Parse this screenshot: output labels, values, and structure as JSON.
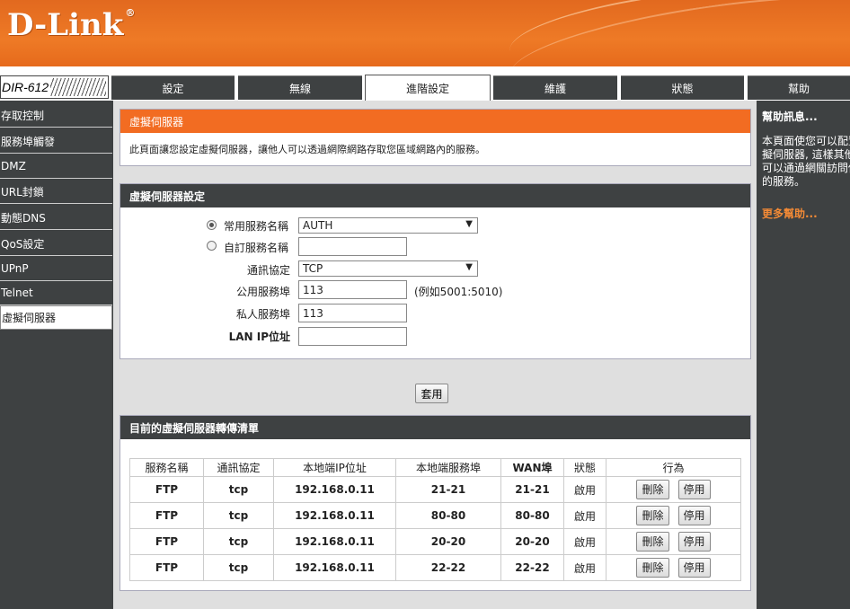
{
  "brand": {
    "logo": "D-Link",
    "model": "DIR-612"
  },
  "tabs": [
    {
      "label": "設定",
      "active": false
    },
    {
      "label": "無線",
      "active": false
    },
    {
      "label": "進階設定",
      "active": true
    },
    {
      "label": "維護",
      "active": false
    },
    {
      "label": "狀態",
      "active": false
    },
    {
      "label": "幫助",
      "active": false
    }
  ],
  "sidebar": {
    "items": [
      {
        "label": "存取控制",
        "active": false
      },
      {
        "label": "服務埠觸發",
        "active": false
      },
      {
        "label": "DMZ",
        "active": false
      },
      {
        "label": "URL封鎖",
        "active": false
      },
      {
        "label": "動態DNS",
        "active": false
      },
      {
        "label": "QoS設定",
        "active": false
      },
      {
        "label": "UPnP",
        "active": false
      },
      {
        "label": "Telnet",
        "active": false
      },
      {
        "label": "虛擬伺服器",
        "active": true
      }
    ]
  },
  "intro": {
    "title": "虛擬伺服器",
    "description": "此頁面讓您設定虛擬伺服器，讓他人可以透過網際網路存取您區域網路內的服務。"
  },
  "settings": {
    "title": "虛擬伺服器設定",
    "common_service_label": "常用服務名稱",
    "common_service_value": "AUTH",
    "custom_service_label": "自訂服務名稱",
    "custom_service_value": "",
    "protocol_label": "通訊協定",
    "protocol_value": "TCP",
    "public_port_label": "公用服務埠",
    "public_port_value": "113",
    "public_port_hint": "(例如5001:5010)",
    "private_port_label": "私人服務埠",
    "private_port_value": "113",
    "lan_ip_label": "LAN IP位址",
    "lan_ip_value": ""
  },
  "apply_label": "套用",
  "list": {
    "title": "目前的虛擬伺服器轉傳清單",
    "headers": [
      "服務名稱",
      "通訊協定",
      "本地端IP位址",
      "本地端服務埠",
      "WAN埠",
      "狀態",
      "行為"
    ],
    "delete_label": "刪除",
    "disable_label": "停用",
    "rows": [
      {
        "service": "FTP",
        "protocol": "tcp",
        "ip": "192.168.0.11",
        "local_port": "21-21",
        "wan_port": "21-21",
        "status": "啟用"
      },
      {
        "service": "FTP",
        "protocol": "tcp",
        "ip": "192.168.0.11",
        "local_port": "80-80",
        "wan_port": "80-80",
        "status": "啟用"
      },
      {
        "service": "FTP",
        "protocol": "tcp",
        "ip": "192.168.0.11",
        "local_port": "20-20",
        "wan_port": "20-20",
        "status": "啟用"
      },
      {
        "service": "FTP",
        "protocol": "tcp",
        "ip": "192.168.0.11",
        "local_port": "22-22",
        "wan_port": "22-22",
        "status": "啟用"
      }
    ]
  },
  "help": {
    "title": "幫助訊息...",
    "lines": [
      "本頁面使您可以配置",
      "擬伺服器, 這樣其他",
      "可以通過網關訪問你",
      "的服務。"
    ],
    "more": "更多幫助..."
  }
}
